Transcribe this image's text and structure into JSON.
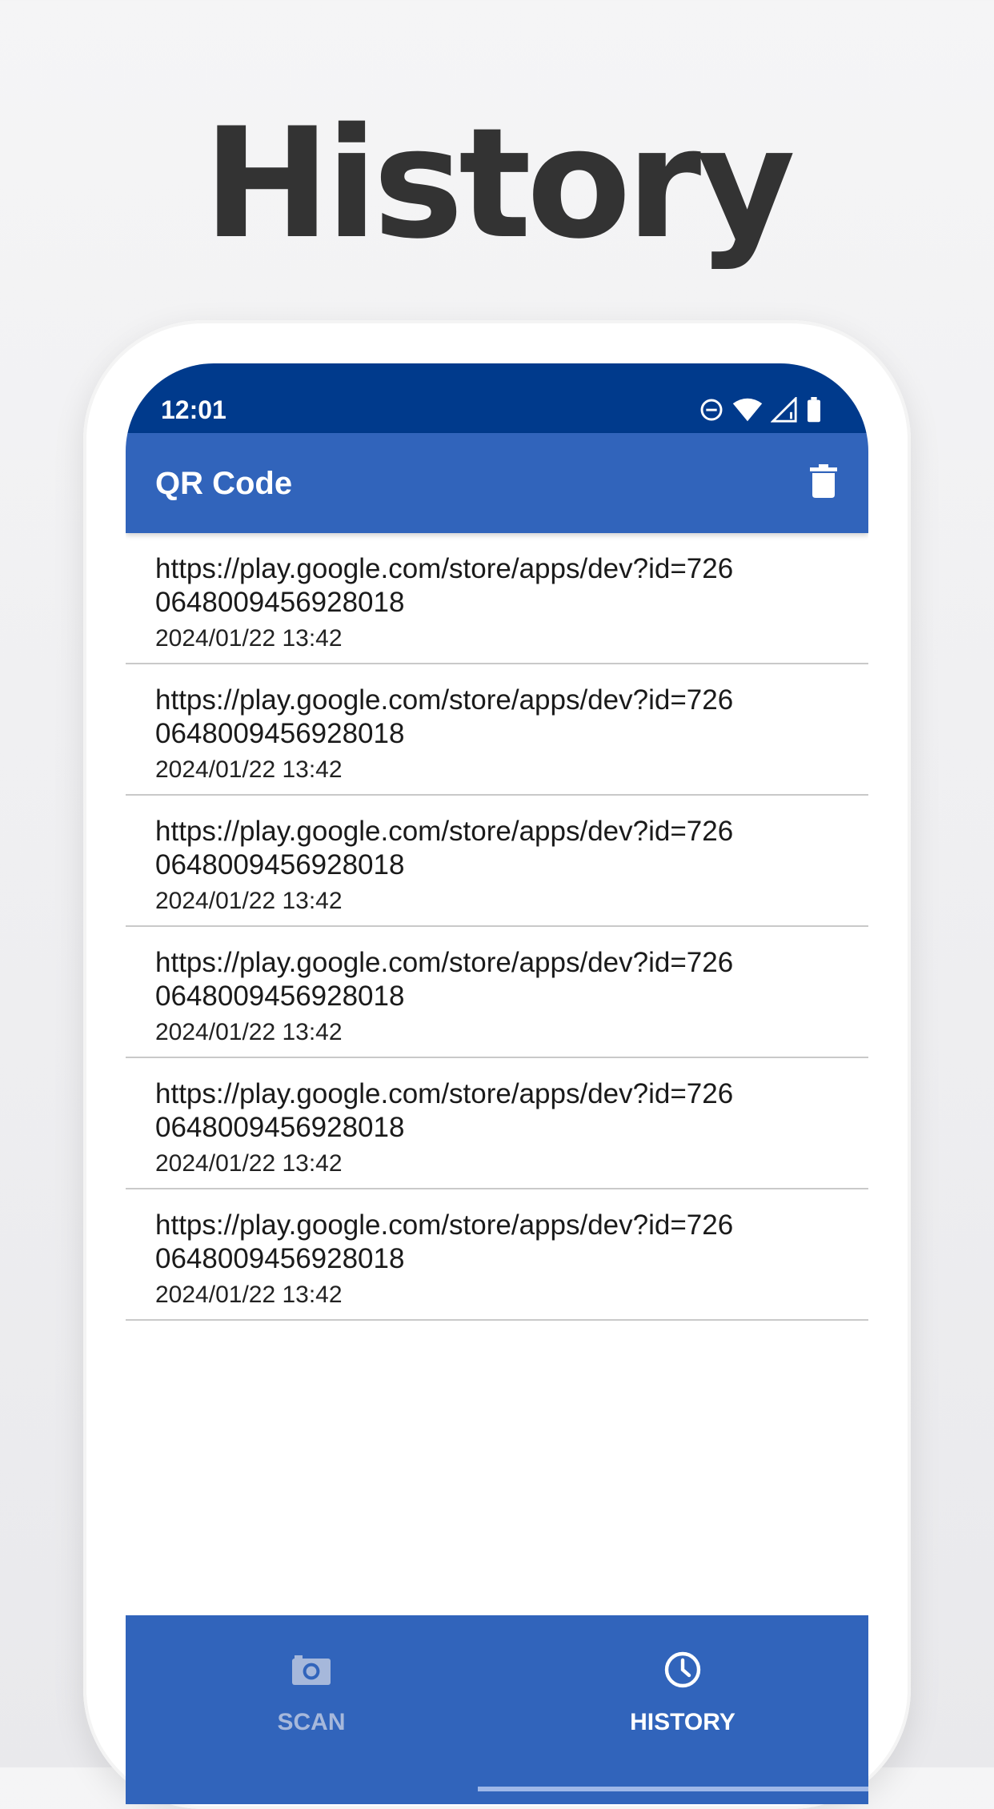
{
  "promo": {
    "title": "History"
  },
  "status_bar": {
    "time": "12:01"
  },
  "app_bar": {
    "title": "QR Code",
    "action_icon": "delete-icon"
  },
  "history": {
    "items": [
      {
        "url": "https://play.google.com/store/apps/dev?id=7260648009456928018",
        "date": "2024/01/22 13:42"
      },
      {
        "url": "https://play.google.com/store/apps/dev?id=7260648009456928018",
        "date": "2024/01/22 13:42"
      },
      {
        "url": "https://play.google.com/store/apps/dev?id=7260648009456928018",
        "date": "2024/01/22 13:42"
      },
      {
        "url": "https://play.google.com/store/apps/dev?id=7260648009456928018",
        "date": "2024/01/22 13:42"
      },
      {
        "url": "https://play.google.com/store/apps/dev?id=7260648009456928018",
        "date": "2024/01/22 13:42"
      },
      {
        "url": "https://play.google.com/store/apps/dev?id=7260648009456928018",
        "date": "2024/01/22 13:42"
      }
    ]
  },
  "bottom_nav": {
    "tabs": [
      {
        "label": "SCAN",
        "icon": "camera-icon",
        "selected": false
      },
      {
        "label": "HISTORY",
        "icon": "clock-icon",
        "selected": true
      }
    ]
  },
  "colors": {
    "status_bar": "#003a8c",
    "primary": "#3164bb",
    "title_text": "#333333"
  }
}
